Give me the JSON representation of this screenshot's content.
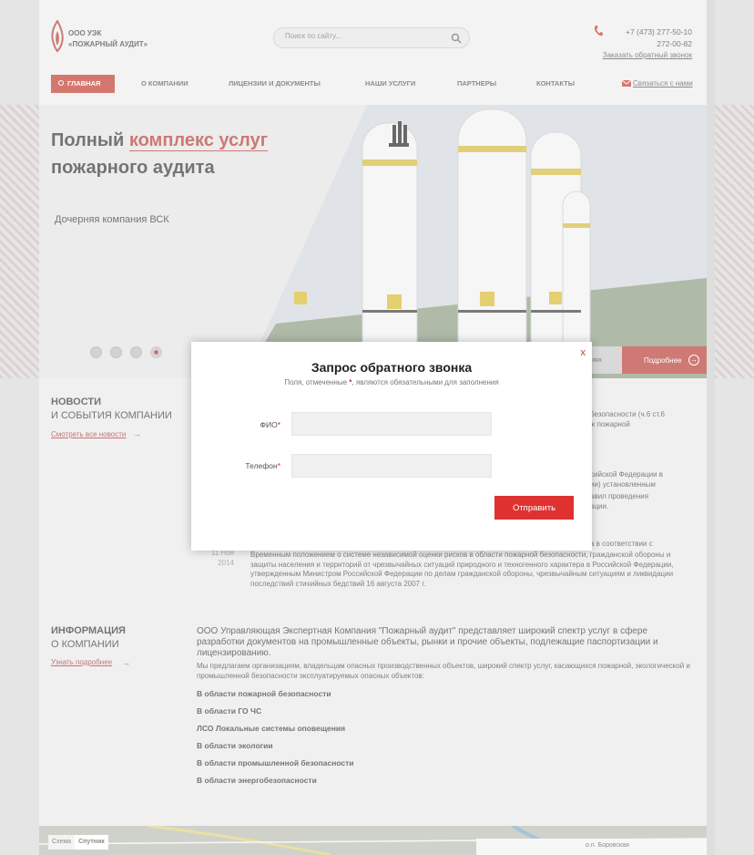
{
  "header": {
    "company_line1": "ООО УЭК",
    "company_line2": "«ПОЖАРНЫЙ АУДИТ»",
    "search_placeholder": "Поиск по сайту...",
    "phone1": "+7 (473) 277-50-10",
    "phone2": "272-00-82",
    "callback_link": "Заказать обратный звонок"
  },
  "nav": {
    "items": [
      "ГЛАВНАЯ",
      "О КОМПАНИИ",
      "ЛИЦЕНЗИИ И ДОКУМЕНТЫ",
      "НАШИ УСЛУГИ",
      "ПАРТНЕРЫ",
      "КОНТАКТЫ"
    ],
    "contact_link": "Связаться с нами"
  },
  "banner": {
    "headline_part1": "Полный",
    "headline_accent": "комплекс услуг",
    "headline_line2": "пожарного аудита",
    "subhead": "Дочерняя компания ВСК",
    "news_label": "...ятиях",
    "more_label": "Подробнее",
    "active_slide": 4,
    "slide_count": 4
  },
  "news": {
    "title_bold": "НОВОСТИ",
    "title_rest": "И СОБЫТИЯ КОМПАНИИ",
    "link": "Смотреть все новости",
    "snippet1": "безопасности (ч.6 ст.6",
    "snippet2": "ж пожарной",
    "snippet3": "сийской Федерации в",
    "snippet4": "ии) установленным",
    "snippet5": "авил проведения",
    "snippet6": "ации.",
    "snippet7": "а в соответствии с",
    "date_day": "11 Ноя",
    "date_year": "2014",
    "body": "Временным положением о системе независимой оценки рисков в области пожарной безопасности, гражданской обороны и защиты населения и территорий от чрезвычайных ситуаций природного и техногенного характера в Российской Федерации, утвержденным Министром Российской Федерации по делам гражданской обороны, чрезвычайным ситуациям и ликвидации последствий стихийных бедствий 16 августа 2007 г."
  },
  "info": {
    "title_bold": "ИНФОРМАЦИЯ",
    "title_rest": "О КОМПАНИИ",
    "link": "Узнать подробнее",
    "lead": "ООО Управляющая Экспертная Компания \"Пожарный аудит\" представляет широкий спектр услуг в сфере разработки документов на промышленные объекты, рынки и прочие объекты, подлежащие паспортизации и лицензированию.",
    "text": "Мы предлагаем организациям, владельцам опасных производственных объектов, широкий спектр услуг, касающихся пожарной, экологической и промышленной безопасности эксплуатируемых опасных объектов:",
    "areas": [
      "В области пожарной безопасности",
      "В области ГО ЧС",
      "ЛСО Локальные системы оповещения",
      "В области экологии",
      "В области промышленной безопасности",
      "В области энергобезопасности"
    ]
  },
  "map": {
    "tab_scheme": "Схема",
    "tab_satellite": "Спутник",
    "place": "о.п. Боровская"
  },
  "modal": {
    "close": "x",
    "title": "Запрос обратного звонка",
    "note_before": "Поля, отмеченные",
    "note_star": "*",
    "note_after": ", являются обязательными для заполнения",
    "name_label": "ФИО",
    "name_value": "",
    "phone_label": "Телефон",
    "phone_value": "",
    "required_mark": "*",
    "submit": "Отправить"
  },
  "colors": {
    "accent": "#c0392b",
    "button": "#e03131"
  }
}
